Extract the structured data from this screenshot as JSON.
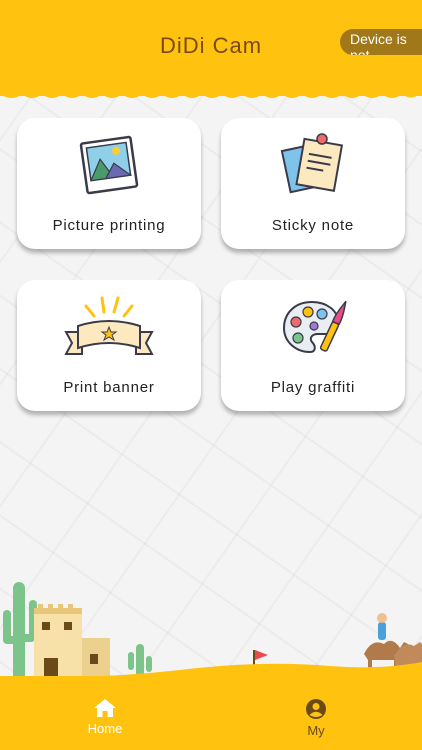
{
  "header": {
    "title": "DiDi Cam",
    "device_status": "Device is not connected",
    "background_color": "#ffc20e"
  },
  "cards": [
    {
      "label": "Picture printing",
      "icon": "photo-icon"
    },
    {
      "label": "Sticky note",
      "icon": "sticky-note-icon"
    },
    {
      "label": "Print banner",
      "icon": "banner-icon"
    },
    {
      "label": "Play graffiti",
      "icon": "palette-icon"
    }
  ],
  "bottom_nav": {
    "items": [
      {
        "label": "Home",
        "icon": "home-icon",
        "active": true
      },
      {
        "label": "My",
        "icon": "user-icon",
        "active": false
      }
    ]
  },
  "colors": {
    "accent": "#ffc20e",
    "title_text": "#7a4a12",
    "status_pill": "#a0781a"
  }
}
